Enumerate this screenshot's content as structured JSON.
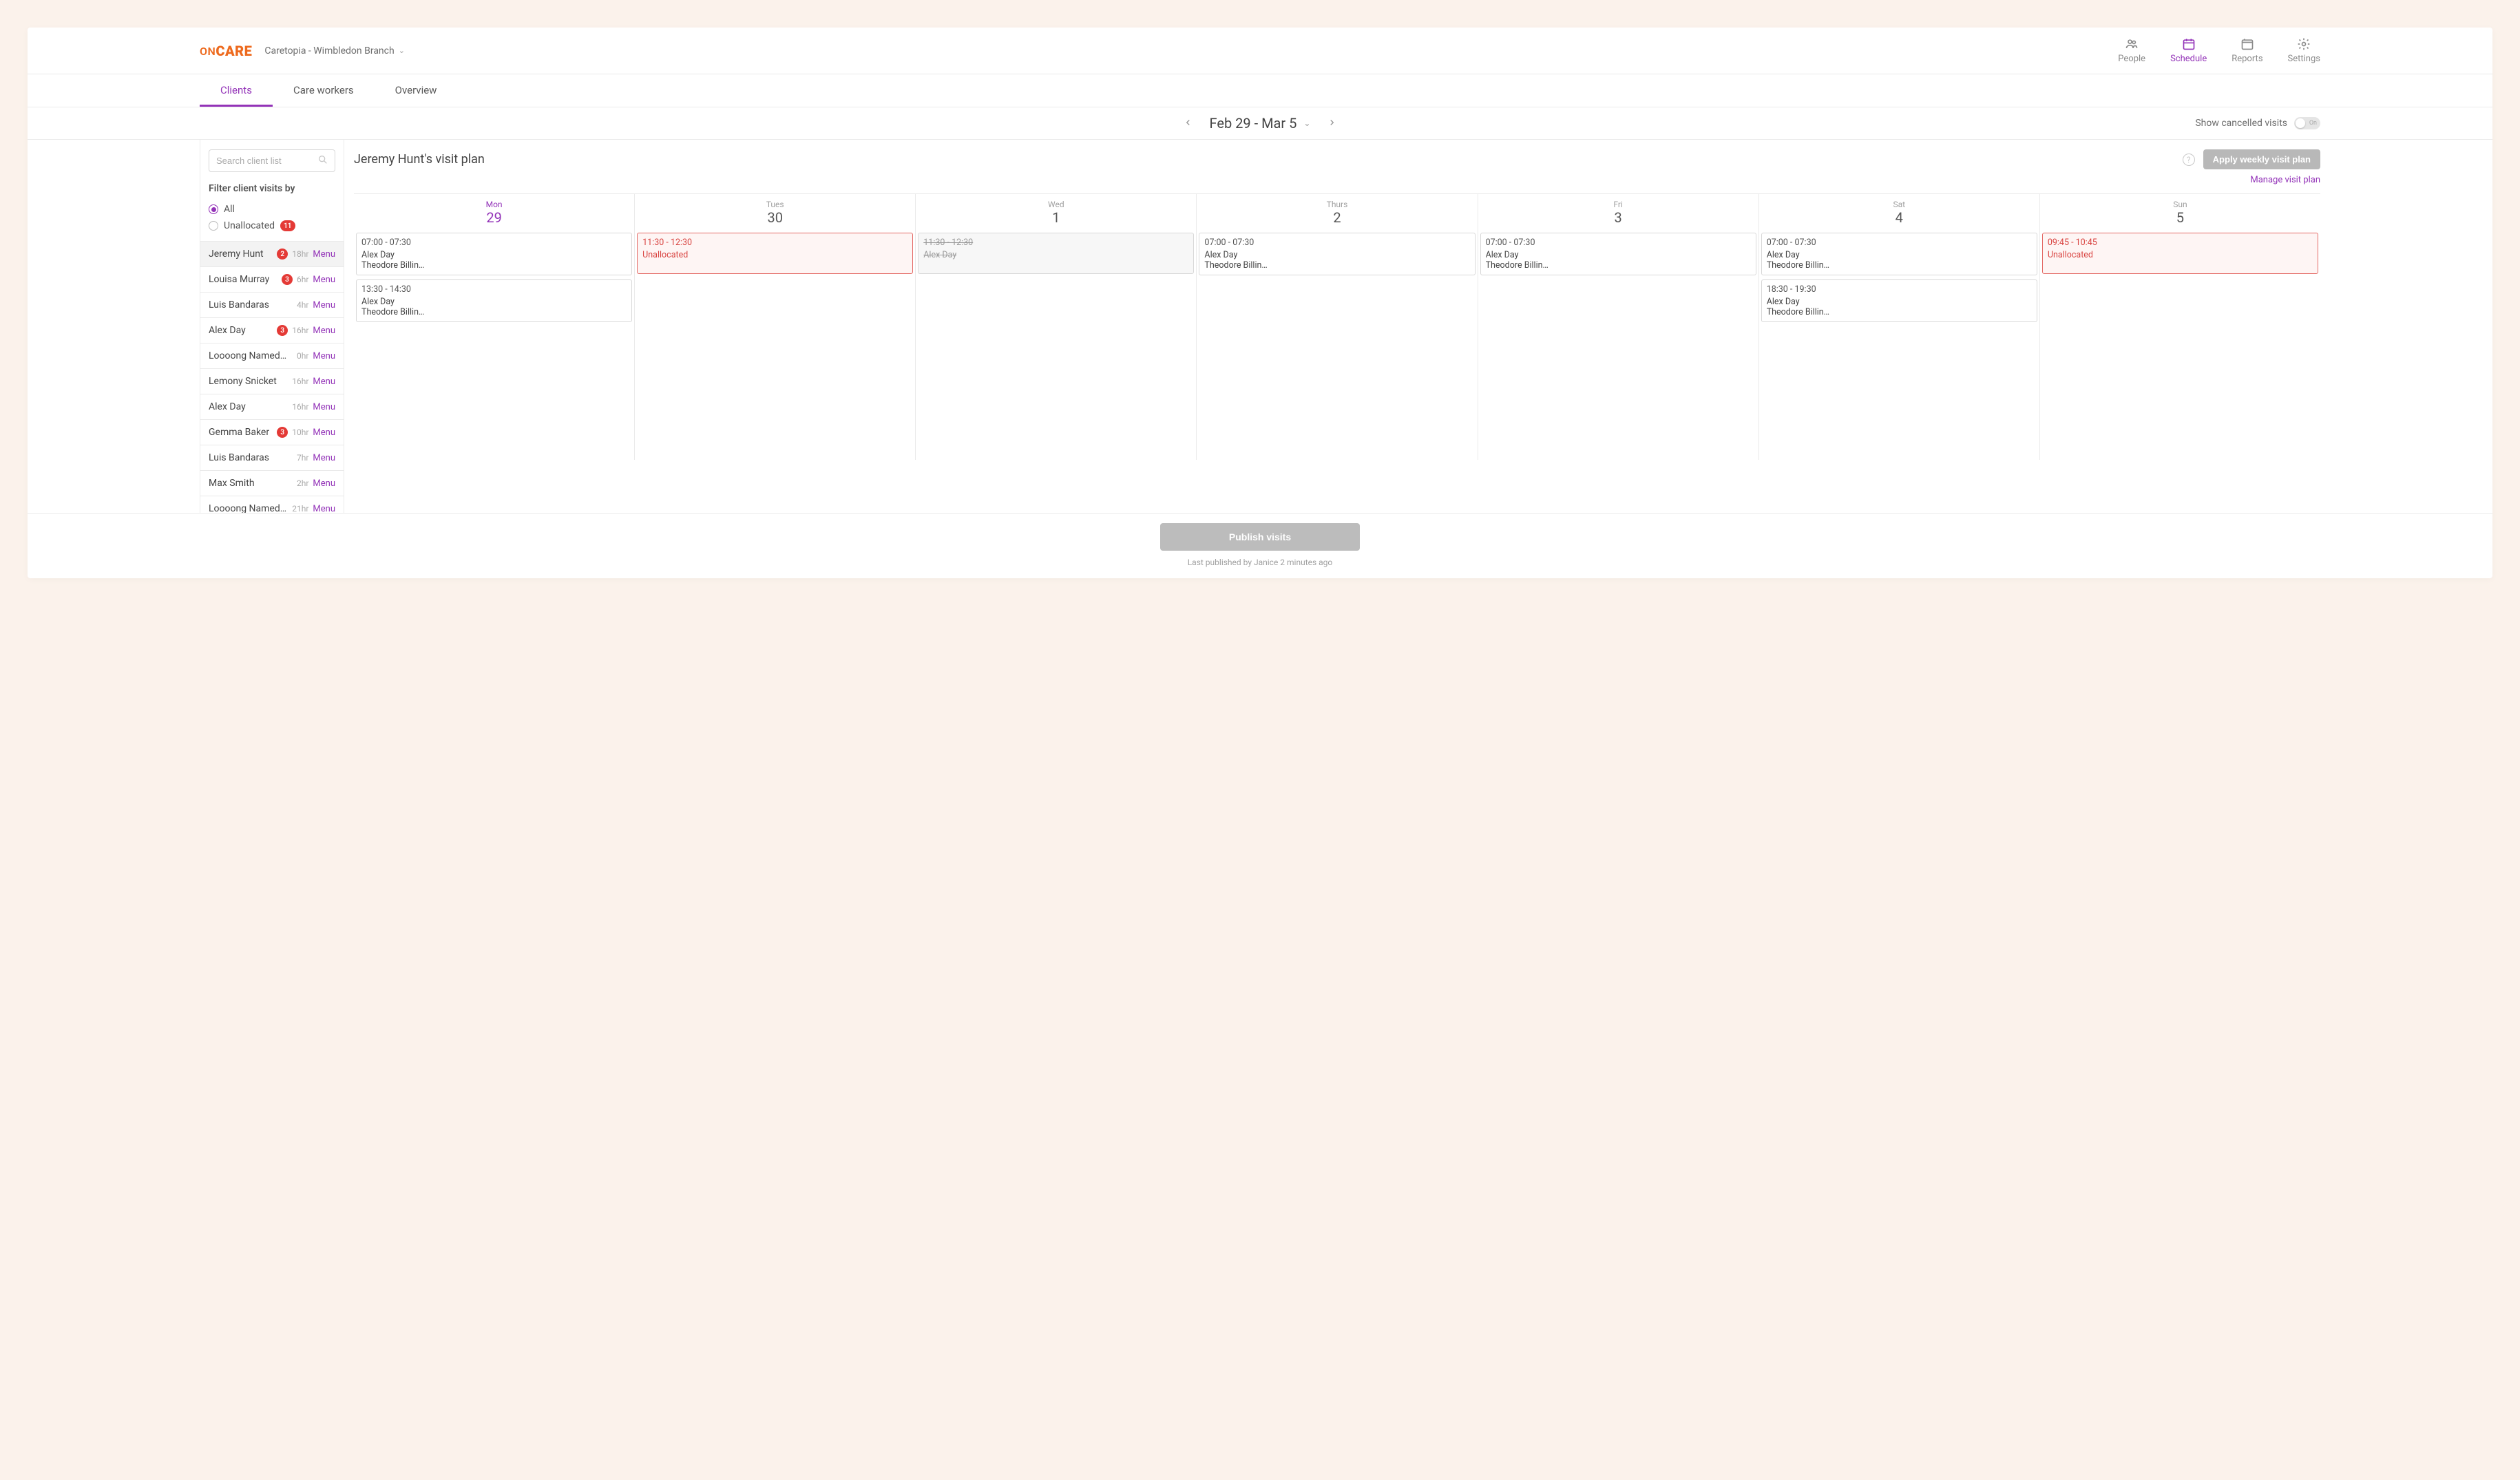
{
  "header": {
    "logo_on": "ON",
    "logo_care": "CARE",
    "branch": "Caretopia - Wimbledon Branch",
    "nav": {
      "people": "People",
      "schedule": "Schedule",
      "reports": "Reports",
      "settings": "Settings"
    }
  },
  "tabs": {
    "clients": "Clients",
    "care_workers": "Care workers",
    "overview": "Overview"
  },
  "datebar": {
    "range": "Feb 29 - Mar 5",
    "cancelled_label": "Show cancelled visits",
    "toggle_state": "On"
  },
  "sidebar": {
    "search_placeholder": "Search client list",
    "filter_title": "Filter client visits by",
    "filter_all": "All",
    "filter_unallocated": "Unallocated",
    "unallocated_count": "11",
    "clients": [
      {
        "name": "Jeremy Hunt",
        "badge": "2",
        "hours": "18hr",
        "menu": "Menu",
        "selected": true
      },
      {
        "name": "Louisa Murray",
        "badge": "3",
        "hours": "6hr",
        "menu": "Menu"
      },
      {
        "name": "Luis Bandaras",
        "badge": "",
        "hours": "4hr",
        "menu": "Menu"
      },
      {
        "name": "Alex Day",
        "badge": "3",
        "hours": "16hr",
        "menu": "Menu"
      },
      {
        "name": "Loooong Named…",
        "badge": "",
        "hours": "0hr",
        "menu": "Menu"
      },
      {
        "name": "Lemony Snicket",
        "badge": "",
        "hours": "16hr",
        "menu": "Menu"
      },
      {
        "name": "Alex Day",
        "badge": "",
        "hours": "16hr",
        "menu": "Menu"
      },
      {
        "name": "Gemma Baker",
        "badge": "3",
        "hours": "10hr",
        "menu": "Menu"
      },
      {
        "name": "Luis Bandaras",
        "badge": "",
        "hours": "7hr",
        "menu": "Menu"
      },
      {
        "name": "Max Smith",
        "badge": "",
        "hours": "2hr",
        "menu": "Menu"
      },
      {
        "name": "Loooong Named…",
        "badge": "",
        "hours": "21hr",
        "menu": "Menu"
      }
    ]
  },
  "main": {
    "title": "Jeremy Hunt's visit plan",
    "apply_button": "Apply weekly visit plan",
    "manage_link": "Manage visit plan",
    "days": [
      {
        "dow": "Mon",
        "num": "29",
        "active": true
      },
      {
        "dow": "Tues",
        "num": "30"
      },
      {
        "dow": "Wed",
        "num": "1"
      },
      {
        "dow": "Thurs",
        "num": "2"
      },
      {
        "dow": "Fri",
        "num": "3"
      },
      {
        "dow": "Sat",
        "num": "4"
      },
      {
        "dow": "Sun",
        "num": "5"
      }
    ],
    "visits": {
      "0": [
        {
          "time": "07:00 - 07:30",
          "lines": [
            "Alex Day",
            "Theodore Billin…"
          ]
        },
        {
          "time": "13:30 - 14:30",
          "lines": [
            "Alex Day",
            "Theodore Billin…"
          ]
        }
      ],
      "1": [
        {
          "time": "11:30 - 12:30",
          "lines": [
            "Unallocated"
          ],
          "kind": "unallocated",
          "tall": true
        }
      ],
      "2": [
        {
          "time": "11:30 - 12:30",
          "lines": [
            "Alex Day"
          ],
          "kind": "cancelled",
          "tall": true
        }
      ],
      "3": [
        {
          "time": "07:00 - 07:30",
          "lines": [
            "Alex Day",
            "Theodore Billin…"
          ]
        }
      ],
      "4": [
        {
          "time": "07:00 - 07:30",
          "lines": [
            "Alex Day",
            "Theodore Billin…"
          ]
        }
      ],
      "5": [
        {
          "time": "07:00 - 07:30",
          "lines": [
            "Alex Day",
            "Theodore Billin…"
          ]
        },
        {
          "time": "18:30 - 19:30",
          "lines": [
            "Alex Day",
            "Theodore Billin…"
          ]
        }
      ],
      "6": [
        {
          "time": "09:45 - 10:45",
          "lines": [
            "Unallocated"
          ],
          "kind": "unallocated",
          "tall": true
        }
      ]
    }
  },
  "footer": {
    "publish": "Publish visits",
    "note": "Last published by Janice 2 minutes ago"
  }
}
